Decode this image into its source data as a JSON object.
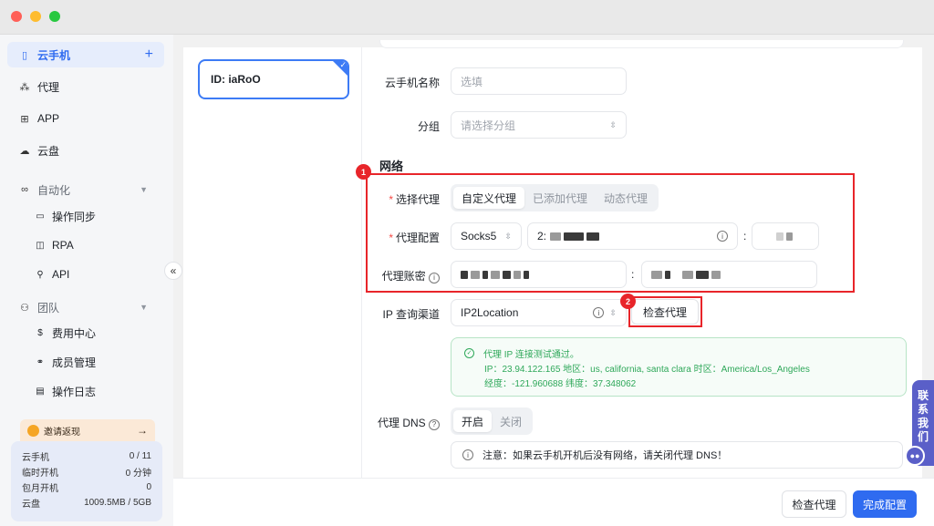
{
  "sidebar": {
    "items": [
      {
        "label": "云手机",
        "icon": "phone-icon",
        "action": "+"
      },
      {
        "label": "代理",
        "icon": "proxy-icon"
      },
      {
        "label": "APP",
        "icon": "apps-grid-icon"
      },
      {
        "label": "云盘",
        "icon": "cloud-icon"
      }
    ],
    "automation": {
      "label": "自动化",
      "icon": "infinity-icon",
      "subitems": [
        {
          "label": "操作同步",
          "icon": "sync-icon"
        },
        {
          "label": "RPA",
          "icon": "robot-icon"
        },
        {
          "label": "API",
          "icon": "api-icon"
        }
      ]
    },
    "team": {
      "label": "团队",
      "icon": "team-icon",
      "subitems": [
        {
          "label": "费用中心",
          "icon": "billing-icon"
        },
        {
          "label": "成员管理",
          "icon": "members-icon"
        },
        {
          "label": "操作日志",
          "icon": "log-icon"
        }
      ]
    },
    "invite": {
      "label": "邀请返现",
      "arrow": "→"
    },
    "stats": [
      {
        "label": "云手机",
        "value": "0 / 11"
      },
      {
        "label": "临时开机",
        "value": "0 分钟"
      },
      {
        "label": "包月开机",
        "value": "0"
      },
      {
        "label": "云盘",
        "value": "1009.5MB / 5GB"
      }
    ],
    "collapse": "«"
  },
  "device": {
    "id_label": "ID: iaRoO"
  },
  "form": {
    "name_label": "云手机名称",
    "name_placeholder": "选填",
    "group_label": "分组",
    "group_placeholder": "请选择分组",
    "network_title": "网络",
    "proxy_select_label": "选择代理",
    "proxy_options": [
      "自定义代理",
      "已添加代理",
      "动态代理"
    ],
    "proxy_config_label": "代理配置",
    "proxy_type": "Socks5",
    "proxy_host_prefix": "2:",
    "proxy_account_label": "代理账密",
    "ip_channel_label": "IP 查询渠道",
    "ip_channel_value": "IP2Location",
    "check_proxy_label": "检查代理",
    "result_line1": "代理 IP 连接测试通过。",
    "result_line2": "IP：23.94.122.165  地区：us, california, santa clara  时区：America/Los_Angeles",
    "result_line3": "经度：-121.960688  纬度：37.348062",
    "dns_label": "代理 DNS",
    "dns_options": [
      "开启",
      "关闭"
    ],
    "dns_notice": "注意：如果云手机开机后没有网络，请关闭代理 DNS！",
    "required_mark": "*",
    "colon": ":"
  },
  "annotations": {
    "badge1": "1",
    "badge2": "2"
  },
  "footer": {
    "check_proxy": "检查代理",
    "finish": "完成配置"
  },
  "contact": {
    "line1": "联",
    "line2": "系",
    "line3": "我",
    "line4": "们"
  }
}
